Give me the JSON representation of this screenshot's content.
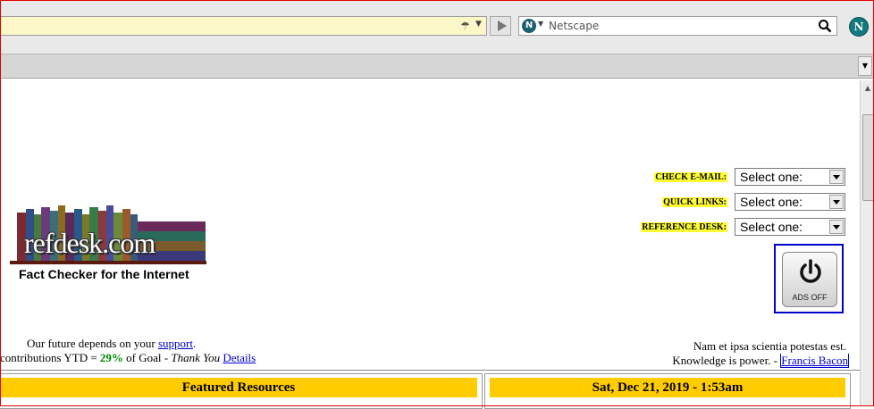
{
  "browser": {
    "search_placeholder": "Netscape",
    "engine_letter": "N",
    "logo_letter": "N"
  },
  "forms": [
    {
      "label": "CHECK E-MAIL:",
      "selected": "Select one:"
    },
    {
      "label": "QUICK LINKS:",
      "selected": "Select one:"
    },
    {
      "label": "REFERENCE DESK:",
      "selected": "Select one:"
    }
  ],
  "ads": {
    "label": "ADS OFF"
  },
  "logo": {
    "word": "refdesk.com",
    "tagline": "Fact Checker for the Internet"
  },
  "support": {
    "prefix": "Our future depends on your ",
    "link": "support",
    "suffix": "."
  },
  "contrib": {
    "prefix": "contributions YTD = ",
    "percent": "29%",
    "middle": " of Goal - ",
    "thanks": "Thank You",
    "link": "Details"
  },
  "quote": {
    "line1": "Nam et ipsa scientia potestas est.",
    "line2_prefix": "Knowledge is power. - ",
    "author": "Francis Bacon"
  },
  "sections": {
    "featured": "Featured Resources",
    "date": "Sat, Dec 21, 2019 - 1:53am"
  },
  "colors": {
    "header_bg": "#ffcc00",
    "label_highlight": "#ffff33",
    "link": "#0000cc",
    "accent_green": "#008800",
    "frame_red": "#e00000"
  }
}
